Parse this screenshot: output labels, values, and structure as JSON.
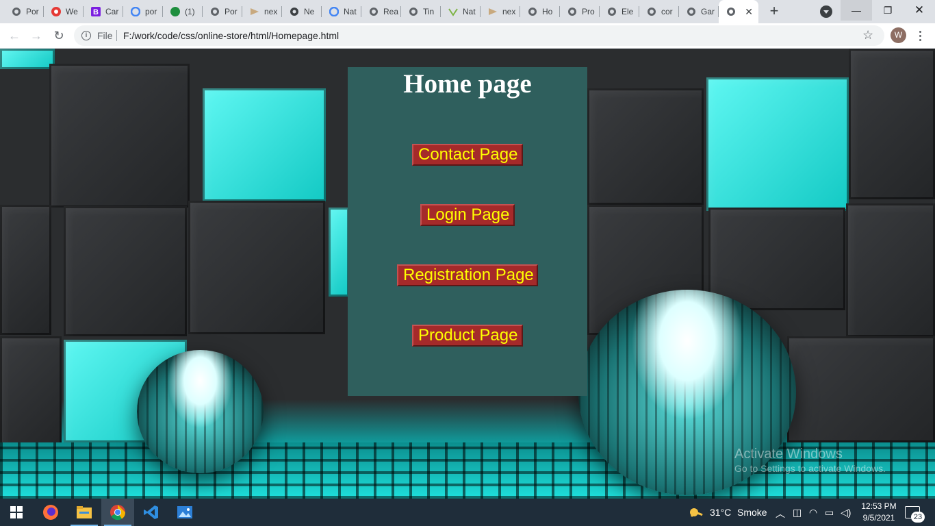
{
  "browser": {
    "tabs": [
      {
        "title": "Por",
        "icon": "globe-icon"
      },
      {
        "title": "We",
        "icon": "red-app-icon"
      },
      {
        "title": "Car",
        "icon": "b-letter-icon"
      },
      {
        "title": "por",
        "icon": "google-icon"
      },
      {
        "title": "(1)",
        "icon": "green-badge-icon"
      },
      {
        "title": "Por",
        "icon": "globe-icon"
      },
      {
        "title": "nex",
        "icon": "arrow-icon"
      },
      {
        "title": "Ne",
        "icon": "chrome-icon"
      },
      {
        "title": "Nat",
        "icon": "google-icon"
      },
      {
        "title": "Rea",
        "icon": "globe-icon"
      },
      {
        "title": "Tin",
        "icon": "globe-icon"
      },
      {
        "title": "Nat",
        "icon": "leaf-icon"
      },
      {
        "title": "nex",
        "icon": "arrow-icon"
      },
      {
        "title": "Ho",
        "icon": "globe-icon"
      },
      {
        "title": "Pro",
        "icon": "globe-icon"
      },
      {
        "title": "Ele",
        "icon": "globe-icon"
      },
      {
        "title": "cor",
        "icon": "globe-icon"
      },
      {
        "title": "Gar",
        "icon": "globe-icon"
      },
      {
        "title": "",
        "icon": "globe-icon",
        "active": true
      }
    ],
    "new_tab": "+",
    "window": {
      "minimize": "—",
      "maximize": "❐",
      "close": "✕"
    },
    "address": {
      "scheme_label": "File",
      "url": "F:/work/code/css/online-store/html/Homepage.html"
    },
    "profile_initial": "W"
  },
  "page": {
    "heading": "Home page",
    "buttons": {
      "contact": "Contact Page",
      "login": "Login Page",
      "registration": "Registration Page",
      "product": "Product Page"
    },
    "colors": {
      "panel_bg": "#2f5f5d",
      "button_bg": "#a52a2a",
      "button_text": "#ffff00",
      "heading": "#ffffff"
    }
  },
  "watermark": {
    "line1": "Activate Windows",
    "line2": "Go to Settings to activate Windows."
  },
  "taskbar": {
    "apps": [
      "windows-start",
      "firefox",
      "file-explorer",
      "chrome",
      "vscode",
      "photos"
    ],
    "weather": {
      "temp": "31°C",
      "condition": "Smoke"
    },
    "clock": {
      "time": "12:53 PM",
      "date": "9/5/2021"
    },
    "notification_count": "23"
  }
}
